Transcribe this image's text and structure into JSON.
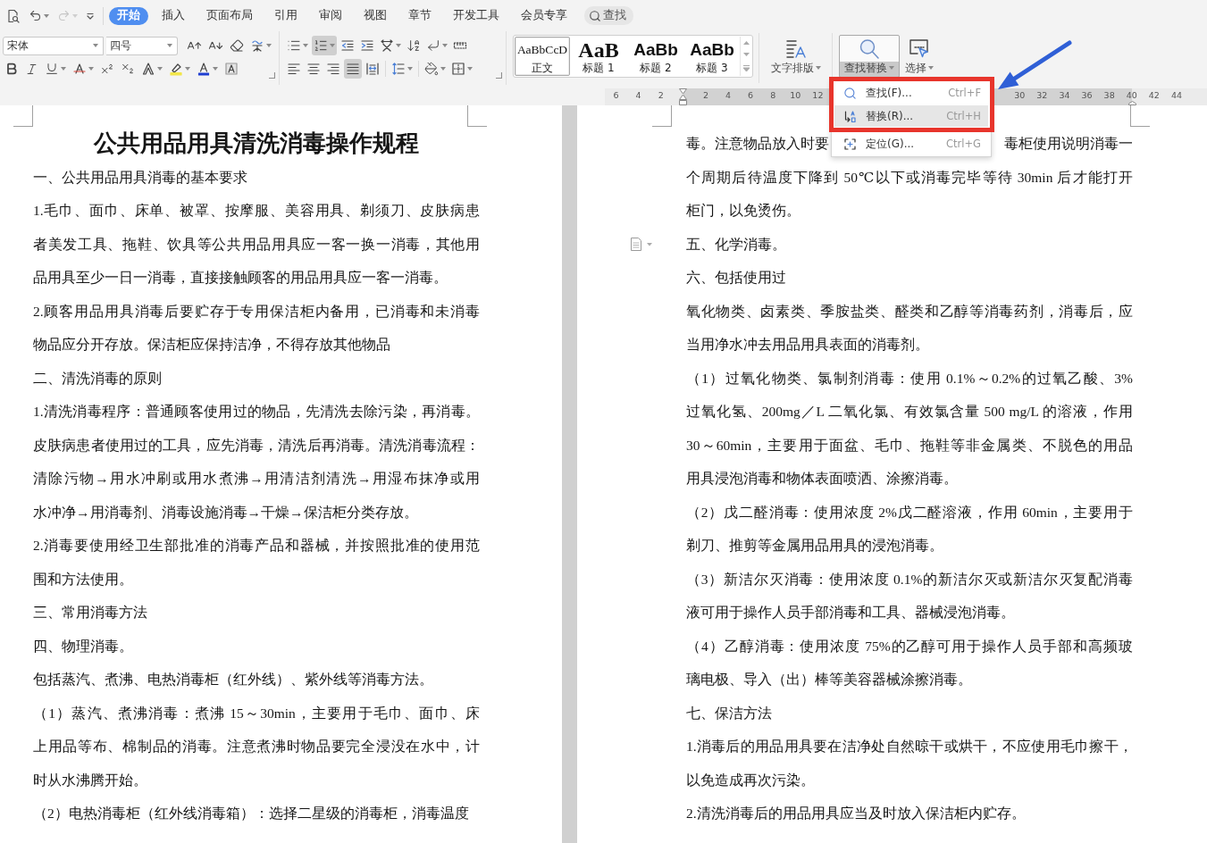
{
  "quick_access": [
    {
      "kind": "preview",
      "disabled": false
    },
    {
      "kind": "undo",
      "disabled": false
    },
    {
      "kind": "redo",
      "disabled": true
    },
    {
      "kind": "customize",
      "disabled": false
    }
  ],
  "tabs": [
    {
      "label": "开始",
      "selected": true
    },
    {
      "label": "插入",
      "selected": false
    },
    {
      "label": "页面布局",
      "selected": false
    },
    {
      "label": "引用",
      "selected": false
    },
    {
      "label": "审阅",
      "selected": false
    },
    {
      "label": "视图",
      "selected": false
    },
    {
      "label": "章节",
      "selected": false
    },
    {
      "label": "开发工具",
      "selected": false
    },
    {
      "label": "会员专享",
      "selected": false
    }
  ],
  "search_button": {
    "label": "查找"
  },
  "font": {
    "name": "宋体",
    "size": "四号"
  },
  "paragraph_tools": {
    "row_1": [
      {
        "kind": "bullets",
        "active": false
      },
      {
        "kind": "numbering",
        "active": true
      },
      {
        "kind": "outdent",
        "active": false
      },
      {
        "kind": "indent",
        "active": false
      },
      {
        "kind": "asian-layout",
        "active": false
      },
      {
        "kind": "sort",
        "active": false
      },
      {
        "kind": "marks",
        "active": false
      },
      {
        "kind": "tab-ruler",
        "active": false
      }
    ],
    "row_2": [
      {
        "kind": "align-left",
        "active": false
      },
      {
        "kind": "align-center",
        "active": false
      },
      {
        "kind": "align-right",
        "active": false
      },
      {
        "kind": "justify",
        "active": true
      },
      {
        "kind": "distribute",
        "active": false
      },
      {
        "kind": "line-spacing",
        "active": false
      },
      {
        "kind": "shading",
        "active": false
      },
      {
        "kind": "borders",
        "active": false
      }
    ]
  },
  "styles": [
    {
      "kind": "normal",
      "preview": "AaBbCcD",
      "label": "正文",
      "selected": true
    },
    {
      "kind": "heading-1",
      "preview": "AaB",
      "label": "标题 1",
      "selected": false
    },
    {
      "kind": "heading-2",
      "preview": "AaBb",
      "label": "标题 2",
      "selected": false
    },
    {
      "kind": "heading-3",
      "preview": "AaBb",
      "label": "标题 3",
      "selected": false
    }
  ],
  "big_buttons": [
    {
      "kind": "text-layout",
      "label": "文字排版",
      "pressed": false
    },
    {
      "kind": "find-replace",
      "label": "查找替换",
      "pressed": true
    },
    {
      "kind": "select",
      "label": "选择",
      "pressed": false
    }
  ],
  "ruler": {
    "left_numbers": [
      "6",
      "4",
      "2"
    ],
    "right_numbers": [
      "2",
      "4",
      "6",
      "8",
      "10",
      "12"
    ],
    "far_numbers": [
      "30",
      "32",
      "34",
      "36",
      "38",
      "40",
      "42",
      "44"
    ]
  },
  "find_menu": {
    "items": [
      {
        "kind": "find",
        "label": "查找(F)...",
        "shortcut": "Ctrl+F",
        "highlighted": false
      },
      {
        "kind": "replace",
        "label": "替换(R)...",
        "shortcut": "Ctrl+H",
        "highlighted": true
      },
      {
        "kind": "goto",
        "label": "定位(G)...",
        "shortcut": "Ctrl+G",
        "highlighted": false
      }
    ]
  },
  "left_page": {
    "title": "公共用品用具清洗消毒操作规程",
    "paragraphs": [
      {
        "kind": "text",
        "lines": [
          "一、公共用品用具消毒的基本要求"
        ]
      },
      {
        "kind": "text",
        "lines": [
          "1.毛巾、面巾、床单、被罩、按摩服、美容用具、剃须刀、皮肤病患",
          "者美发工具、拖鞋、饮具等公共用品用具应一客一换一消毒，其他用",
          "品用具至少一日一消毒，直接接触顾客的用品用具应一客一消毒。"
        ]
      },
      {
        "kind": "text",
        "lines": [
          "2.顾客用品用具消毒后要贮存于专用保洁柜内备用，已消毒和未消毒",
          "物品应分开存放。保洁柜应保持洁净，不得存放其他物品"
        ]
      },
      {
        "kind": "text",
        "lines": [
          "二、清洗消毒的原则"
        ]
      },
      {
        "kind": "text",
        "lines": [
          "1.清洗消毒程序：普通顾客使用过的物品，先清洗去除污染，再消毒。",
          "皮肤病患者使用过的工具，应先消毒，清洗后再消毒。清洗消毒流程：",
          "清除污物→用水冲刷或用水煮沸→用清洁剂清洗→用湿布抹净或用",
          "水冲净→用消毒剂、消毒设施消毒→干燥→保洁柜分类存放。"
        ]
      },
      {
        "kind": "text",
        "lines": [
          "2.消毒要使用经卫生部批准的消毒产品和器械，并按照批准的使用范",
          "围和方法使用。"
        ]
      },
      {
        "kind": "text",
        "lines": [
          "三、常用消毒方法"
        ]
      },
      {
        "kind": "text",
        "lines": [
          "四、物理消毒。"
        ]
      },
      {
        "kind": "text",
        "lines": [
          "包括蒸汽、煮沸、电热消毒柜（红外线）、紫外线等消毒方法。"
        ]
      },
      {
        "kind": "text",
        "lines": [
          "（1）蒸汽、煮沸消毒：煮沸 15～30min，主要用于毛巾、面巾、床",
          "上用品等布、棉制品的消毒。注意煮沸时物品要完全浸没在水中，计",
          "时从水沸腾开始。"
        ]
      },
      {
        "kind": "text",
        "lines": [
          "（2）电热消毒柜（红外线消毒箱）：选择二星级的消毒柜，消毒温度"
        ]
      }
    ]
  },
  "right_page": {
    "paragraphs": [
      {
        "kind": "split",
        "parts": [
          "毒。注意物品放入时要",
          "毒柜使用说明消毒一"
        ]
      },
      {
        "kind": "text",
        "lines": [
          "个周期后待温度下降到 50℃以下或消毒完毕等待 30min 后才能打开",
          "柜门，以免烫伤。"
        ]
      },
      {
        "kind": "text",
        "lines": [
          "五、化学消毒。"
        ]
      },
      {
        "kind": "text",
        "lines": [
          "六、包括使用过"
        ]
      },
      {
        "kind": "text",
        "lines": [
          "氧化物类、卤素类、季胺盐类、醛类和乙醇等消毒药剂，消毒后，应",
          "当用净水冲去用品用具表面的消毒剂。"
        ]
      },
      {
        "kind": "text",
        "lines": [
          "（1）过氧化物类、氯制剂消毒：使用 0.1%～0.2%的过氧乙酸、3%",
          "过氧化氢、200mg／L 二氧化氯、有效氯含量 500 mg/L 的溶液，作用",
          "30～60min，主要用于面盆、毛巾、拖鞋等非金属类、不脱色的用品",
          "用具浸泡消毒和物体表面喷洒、涂擦消毒。"
        ]
      },
      {
        "kind": "text",
        "lines": [
          "（2）戊二醛消毒：使用浓度 2%戊二醛溶液，作用 60min，主要用于",
          "剃刀、推剪等金属用品用具的浸泡消毒。"
        ]
      },
      {
        "kind": "text",
        "lines": [
          "（3）新洁尔灭消毒：使用浓度 0.1%的新洁尔灭或新洁尔灭复配消毒",
          "液可用于操作人员手部消毒和工具、器械浸泡消毒。"
        ]
      },
      {
        "kind": "text",
        "lines": [
          "（4）乙醇消毒：使用浓度 75%的乙醇可用于操作人员手部和高频玻",
          "璃电极、导入（出）棒等美容器械涂擦消毒。"
        ]
      },
      {
        "kind": "text",
        "lines": [
          "七、保洁方法"
        ]
      },
      {
        "kind": "text",
        "lines": [
          "1.消毒后的用品用具要在洁净处自然晾干或烘干，不应使用毛巾擦干，",
          "以免造成再次污染。"
        ]
      },
      {
        "kind": "text",
        "lines": [
          "2.清洗消毒后的用品用具应当及时放入保洁柜内贮存。"
        ]
      }
    ]
  }
}
